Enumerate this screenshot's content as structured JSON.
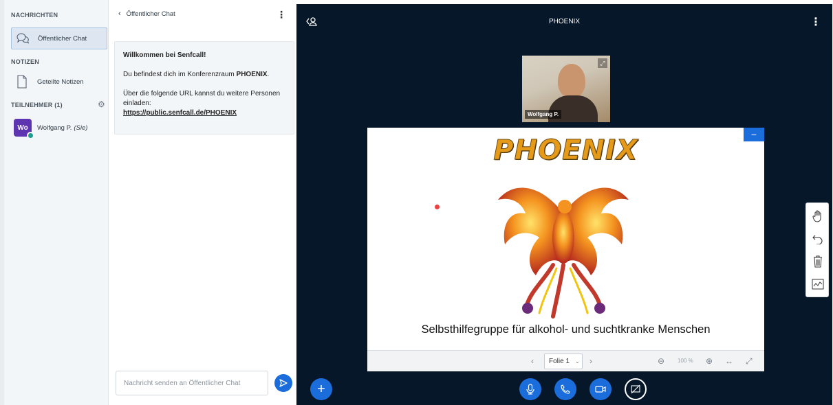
{
  "left_panel": {
    "messages_title": "NACHRICHTEN",
    "public_chat_label": "Öffentlicher Chat",
    "notes_title": "NOTIZEN",
    "shared_notes_label": "Geteilte Notizen",
    "participants_title": "TEILNEHMER (1)",
    "user": {
      "initials": "Wo",
      "name": "Wolfgang P.",
      "suffix": "(Sie)",
      "avatar_color": "#5e35b1"
    }
  },
  "chat": {
    "header_title": "Öffentlicher Chat",
    "welcome_title": "Willkommen bei Senfcall!",
    "welcome_line1_prefix": "Du befindest dich im Konferenzraum ",
    "welcome_room": "PHOENIX",
    "welcome_line1_suffix": ".",
    "welcome_line2": "Über die folgende URL kannst du weitere Personen einladen:",
    "welcome_url": "https://public.senfcall.de/PHOENIX",
    "input_placeholder": "Nachricht senden an Öffentlicher Chat"
  },
  "main": {
    "room_title": "PHOENIX",
    "webcam_name": "Wolfgang P.",
    "slide": {
      "logo_text": "PHOENIX",
      "caption": "Selbsthilfegruppe für alkohol- und suchtkranke Menschen"
    },
    "slide_controls": {
      "current_slide": "Folie 1",
      "zoom": "100 %"
    }
  },
  "icons": {
    "accent": "#1b6ddb",
    "dark_bg": "#06172a"
  }
}
